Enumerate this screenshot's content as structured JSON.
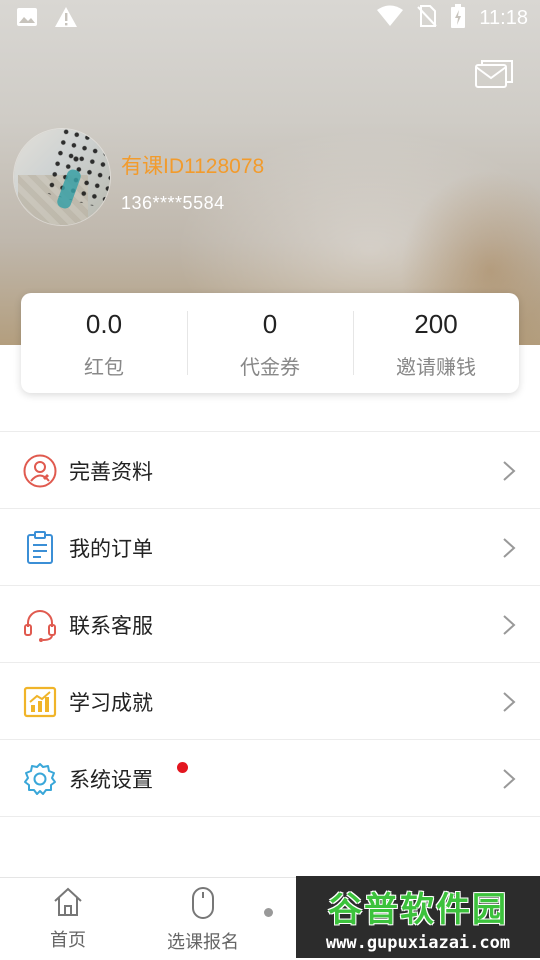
{
  "status_bar": {
    "time": "11:18",
    "left_icons": [
      "image-icon",
      "warning-icon"
    ],
    "right_icons": [
      "wifi-icon",
      "no-sim-icon",
      "battery-charging-icon"
    ]
  },
  "header": {
    "message_icon": "mail-icon",
    "user_name": "有课ID1128078",
    "phone": "136****5584"
  },
  "stats": [
    {
      "value": "0.0",
      "label": "红包"
    },
    {
      "value": "0",
      "label": "代金券"
    },
    {
      "value": "200",
      "label": "邀请赚钱"
    }
  ],
  "menu": [
    {
      "label": "完善资料",
      "icon": "profile-icon",
      "color": "#e05a4f"
    },
    {
      "label": "我的订单",
      "icon": "order-clipboard-icon",
      "color": "#3b8fd6"
    },
    {
      "label": "联系客服",
      "icon": "headset-icon",
      "color": "#e05a4f"
    },
    {
      "label": "学习成就",
      "icon": "achievement-chart-icon",
      "color": "#f0b429"
    },
    {
      "label": "系统设置",
      "icon": "settings-gear-icon",
      "color": "#3aa7d9",
      "badge": "red-dot"
    }
  ],
  "bottom_nav": [
    {
      "label": "首页",
      "icon": "home-icon"
    },
    {
      "label": "选课报名",
      "icon": "mouse-icon"
    }
  ],
  "watermark": {
    "title": "谷普软件园",
    "url": "www.gupuxiazai.com"
  },
  "colors": {
    "accent_orange": "#f29b2c",
    "badge_red": "#e3161f"
  }
}
